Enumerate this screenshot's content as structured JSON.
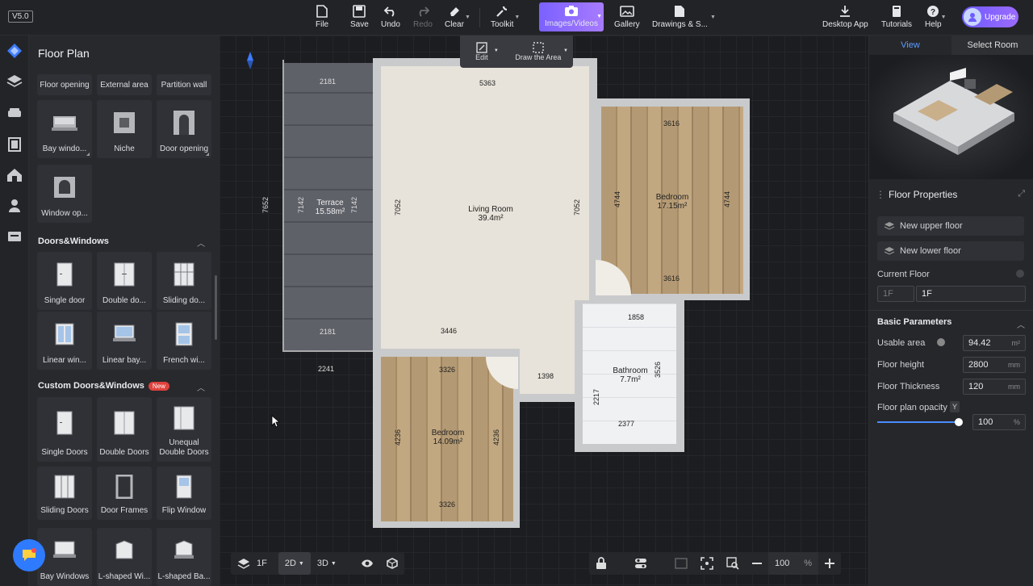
{
  "app": {
    "version": "V5.0"
  },
  "toolbar": {
    "file": "File",
    "save": "Save",
    "undo": "Undo",
    "redo": "Redo",
    "clear": "Clear",
    "toolkit": "Toolkit",
    "images_videos": "Images/Videos",
    "gallery": "Gallery",
    "drawings": "Drawings & S...",
    "desktop_app": "Desktop App",
    "tutorials": "Tutorials",
    "help": "Help",
    "upgrade": "Upgrade"
  },
  "left_panel": {
    "title": "Floor Plan",
    "chips": [
      "Floor opening",
      "External area",
      "Partition wall"
    ],
    "openings": [
      "Bay windo...",
      "Niche",
      "Door opening",
      "Window op..."
    ],
    "doors_windows": {
      "title": "Doors&Windows",
      "items": [
        "Single door",
        "Double do...",
        "Sliding do...",
        "Linear win...",
        "Linear bay...",
        "French wi..."
      ]
    },
    "custom": {
      "title": "Custom Doors&Windows",
      "badge": "New",
      "items": [
        "Single Doors",
        "Double Doors",
        "Unequal Double Doors",
        "Sliding Doors",
        "Door Frames",
        "Flip Window",
        "Bay Windows",
        "L-shaped Wi...",
        "L-shaped Ba..."
      ]
    }
  },
  "canvas": {
    "float_tools": {
      "edit": "Edit",
      "draw_area": "Draw the Area"
    },
    "rooms": {
      "terrace": {
        "name": "Terrace",
        "area": "15.58m²"
      },
      "living": {
        "name": "Living Room",
        "area": "39.4m²"
      },
      "bedroom1": {
        "name": "Bedroom",
        "area": "17.15m²"
      },
      "bathroom": {
        "name": "Bathroom",
        "area": "7.7m²"
      },
      "bedroom2": {
        "name": "Bedroom",
        "area": "14.09m²"
      }
    },
    "dims": {
      "terrace_top": "2181",
      "terrace_bottom": "2181",
      "terrace_outer": "2241",
      "terrace_left_outer": "7652",
      "terrace_left": "7142",
      "terrace_right": "7142",
      "living_top": "5363",
      "living_left": "7052",
      "living_right": "7052",
      "living_bottom": "3446",
      "bed1_top": "3616",
      "bed1_bottom": "3616",
      "bed1_left": "4744",
      "bed1_right": "4744",
      "bath_top": "1858",
      "bath_right": "3526",
      "bath_left": "2217",
      "bath_bottom": "2377",
      "corridor": "1398",
      "bed2_top": "3326",
      "bed2_bottom": "3326",
      "bed2_left": "4236",
      "bed2_right": "4236"
    },
    "bottom": {
      "floor": "1F",
      "view2d": "2D",
      "view3d": "3D",
      "zoom": "100",
      "zoom_unit": "%"
    }
  },
  "right_panel": {
    "tabs": [
      "View",
      "Select Room"
    ],
    "floor_properties": "Floor Properties",
    "new_upper": "New upper floor",
    "new_lower": "New lower floor",
    "current_floor_label": "Current Floor",
    "current_floor_prefix": "1F",
    "current_floor_value": "1F",
    "basic_parameters": "Basic Parameters",
    "usable_area_label": "Usable area",
    "usable_area": "94.42",
    "usable_area_unit": "m²",
    "floor_height_label": "Floor height",
    "floor_height": "2800",
    "floor_thickness_label": "Floor Thickness",
    "floor_thickness": "120",
    "mm": "mm",
    "opacity_label": "Floor plan opacity",
    "opacity_toggle": "Y",
    "opacity": "100",
    "opacity_unit": "%",
    "opacity_level": 1.0
  }
}
